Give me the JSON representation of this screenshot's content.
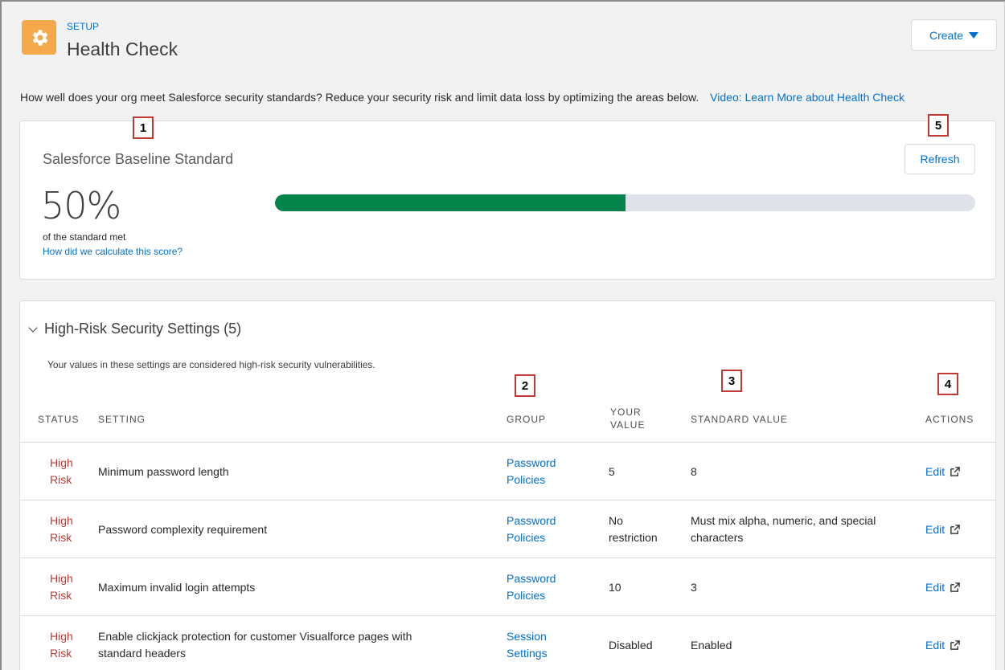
{
  "header": {
    "breadcrumb": "SETUP",
    "title": "Health Check",
    "create_label": "Create",
    "app_icon": "gear-icon",
    "app_icon_color": "#f4a94a"
  },
  "intro": {
    "text": "How well does your org meet Salesforce security standards? Reduce your security risk and limit data loss by optimizing the areas below.",
    "video_link": "Video: Learn More about Health Check"
  },
  "score": {
    "title": "Salesforce Baseline Standard",
    "percent_label": "50%",
    "percent_value": 50,
    "caption": "of the standard met",
    "calc_link": "How did we calculate this score?",
    "refresh_label": "Refresh",
    "bar_color": "#04844b"
  },
  "section": {
    "title": "High-Risk Security Settings (5)",
    "description": "Your values in these settings are considered high-risk security vulnerabilities.",
    "columns": {
      "status": "STATUS",
      "setting": "SETTING",
      "group": "GROUP",
      "your_value_1": "YOUR",
      "your_value_2": "VALUE",
      "standard_value": "STANDARD VALUE",
      "actions": "ACTIONS"
    },
    "rows": [
      {
        "status_1": "High",
        "status_2": "Risk",
        "setting": "Minimum password length",
        "group_1": "Password",
        "group_2": "Policies",
        "your_value_1": "5",
        "your_value_2": "",
        "standard_value_1": "8",
        "standard_value_2": "",
        "action": "Edit"
      },
      {
        "status_1": "High",
        "status_2": "Risk",
        "setting": "Password complexity requirement",
        "group_1": "Password",
        "group_2": "Policies",
        "your_value_1": "No",
        "your_value_2": "restriction",
        "standard_value_1": "Must mix alpha, numeric, and special",
        "standard_value_2": "characters",
        "action": "Edit"
      },
      {
        "status_1": "High",
        "status_2": "Risk",
        "setting": "Maximum invalid login attempts",
        "group_1": "Password",
        "group_2": "Policies",
        "your_value_1": "10",
        "your_value_2": "",
        "standard_value_1": "3",
        "standard_value_2": "",
        "action": "Edit"
      },
      {
        "status_1": "High",
        "status_2": "Risk",
        "setting_1": "Enable clickjack protection for customer Visualforce pages with",
        "setting_2": "standard headers",
        "group_1": "Session",
        "group_2": "Settings",
        "your_value_1": "Disabled",
        "your_value_2": "",
        "standard_value_1": "Enabled",
        "standard_value_2": "",
        "action": "Edit"
      }
    ]
  },
  "callouts": [
    "1",
    "2",
    "3",
    "4",
    "5"
  ],
  "colors": {
    "link": "#0070d2",
    "high_risk": "#c23934",
    "callout_border": "#c23934"
  }
}
